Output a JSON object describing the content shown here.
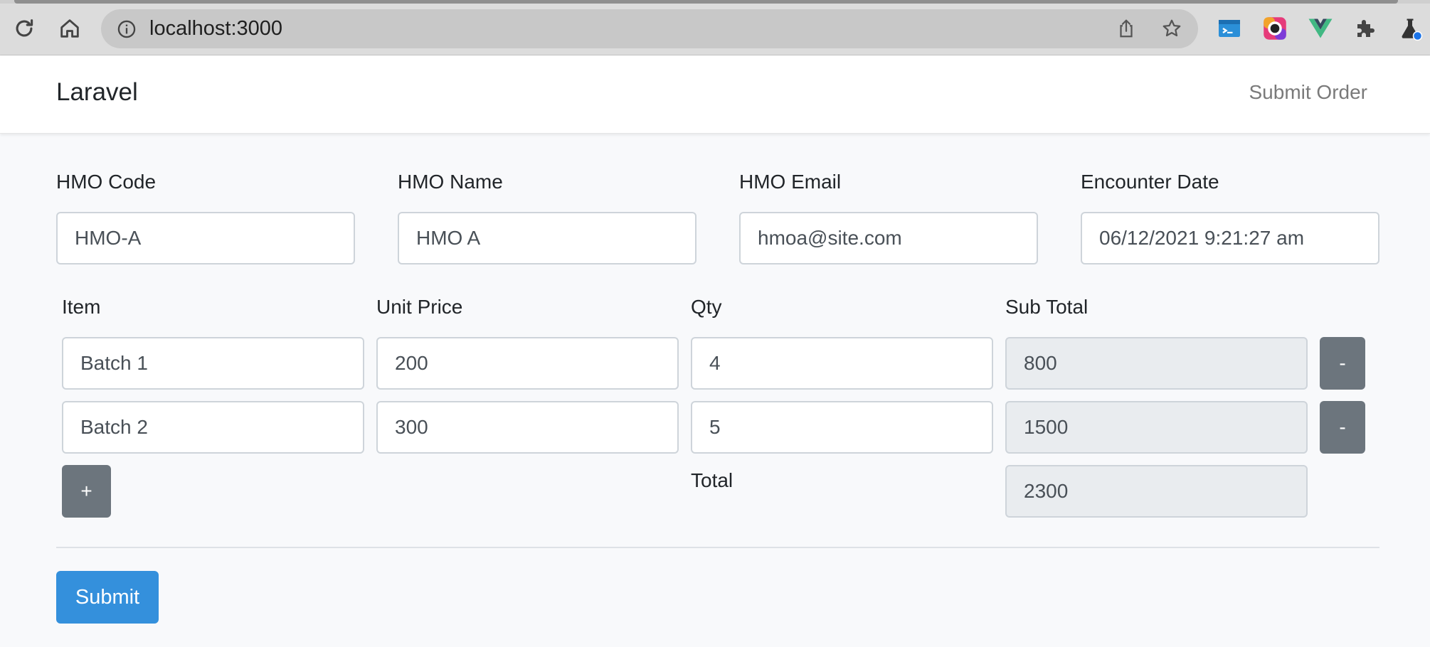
{
  "browser": {
    "url": "localhost:3000",
    "icons": [
      "reload-icon",
      "home-icon",
      "info-icon",
      "share-icon",
      "star-icon",
      "terminal-extension-icon",
      "color-extension-icon",
      "vue-devtools-icon",
      "extensions-puzzle-icon",
      "labs-flask-icon"
    ]
  },
  "navbar": {
    "brand": "Laravel",
    "submit_order_link": "Submit Order"
  },
  "header_fields": {
    "hmo_code": {
      "label": "HMO Code",
      "value": "HMO-A"
    },
    "hmo_name": {
      "label": "HMO Name",
      "value": "HMO A"
    },
    "hmo_email": {
      "label": "HMO Email",
      "value": "hmoa@site.com"
    },
    "encounter_date": {
      "label": "Encounter Date",
      "value": "06/12/2021 9:21:27 am"
    }
  },
  "items_table": {
    "columns": [
      "Item",
      "Unit Price",
      "Qty",
      "Sub Total"
    ],
    "rows": [
      {
        "item": "Batch 1",
        "unit_price": "200",
        "qty": "4",
        "sub_total": "800",
        "remove_label": "-"
      },
      {
        "item": "Batch 2",
        "unit_price": "300",
        "qty": "5",
        "sub_total": "1500",
        "remove_label": "-"
      }
    ],
    "add_label": "+",
    "total_label": "Total",
    "total_value": "2300"
  },
  "form": {
    "submit_label": "Submit"
  },
  "colors": {
    "primary": "#3490dc",
    "secondary": "#6c757d",
    "readonly_bg": "#e9ecef",
    "page_bg": "#f8f9fb"
  }
}
